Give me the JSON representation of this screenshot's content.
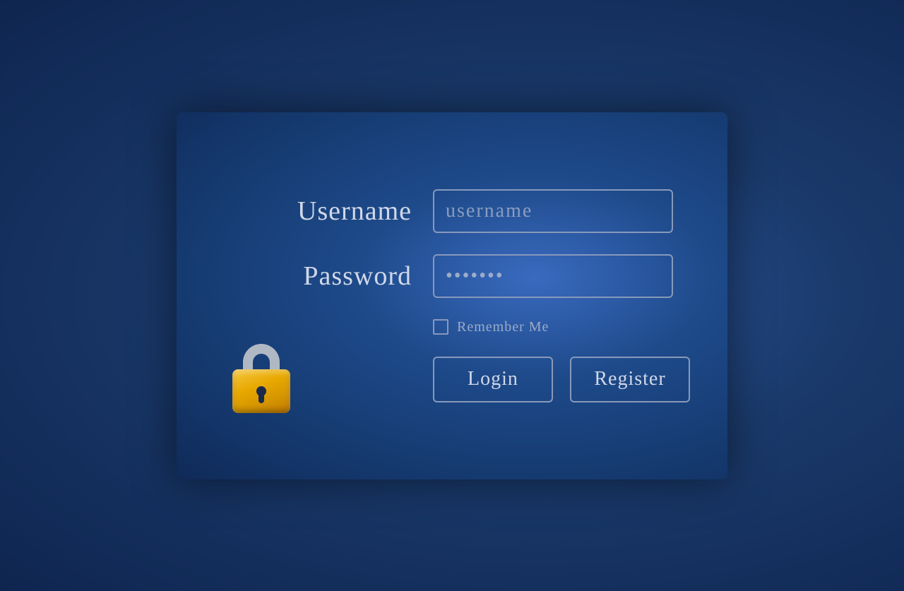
{
  "page": {
    "background_color": "#1a3a6b"
  },
  "form": {
    "username_label": "Username",
    "username_placeholder": "username",
    "password_label": "Password",
    "password_placeholder": "* * * * * * *",
    "remember_me_label": "Remember Me",
    "login_button_label": "Login",
    "register_button_label": "Register"
  }
}
